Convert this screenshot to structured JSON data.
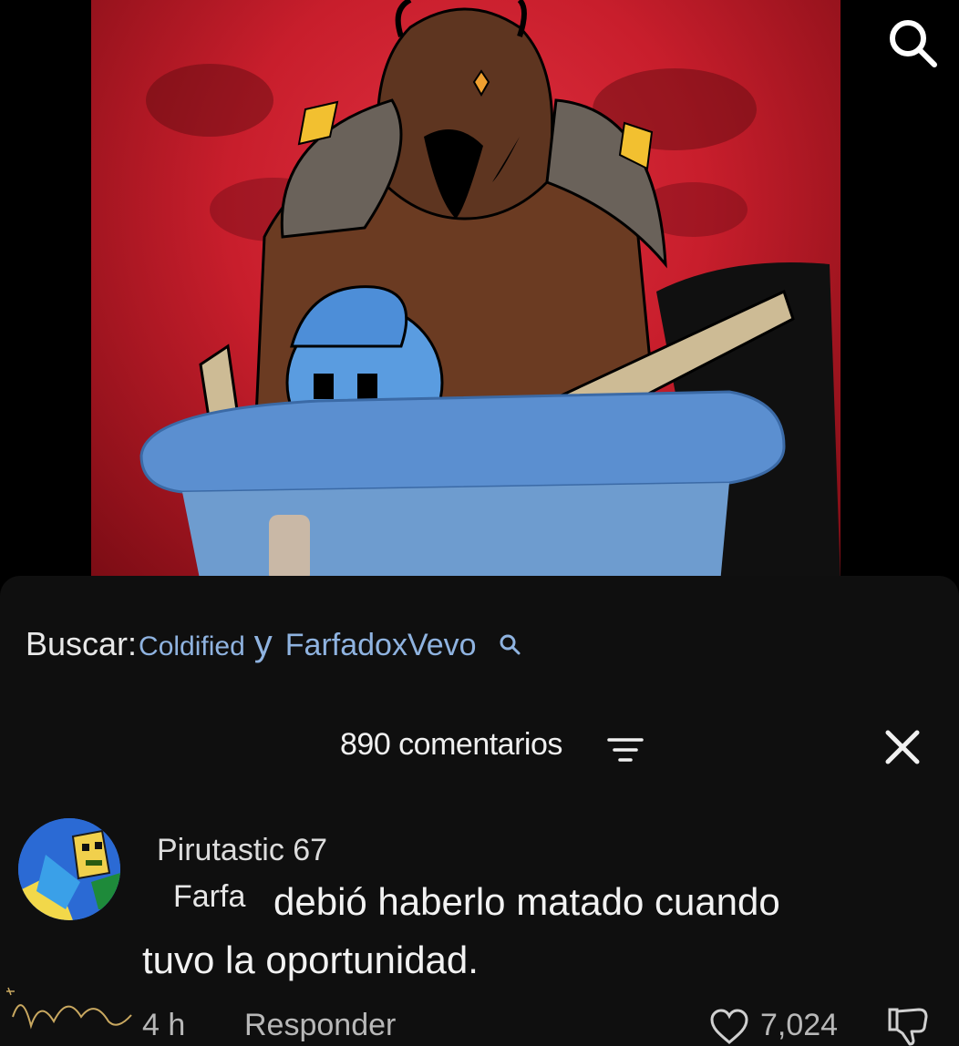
{
  "search": {
    "label": "Buscar:",
    "query_1": "Coldified",
    "joiner": "y",
    "query_2": "FarfadoxVevo"
  },
  "comments": {
    "count_label": "890 comentarios"
  },
  "comment": {
    "author": "Pirutastic 67",
    "text_prefix": "Farfa",
    "text_line1": "debió haberlo matado cuando",
    "text_line2": "tuvo la oportunidad.",
    "time": "4 h",
    "reply_label": "Responder",
    "likes": "7,024"
  },
  "icons": {
    "top_search": "search-icon",
    "inline_search": "search-icon",
    "sort": "sort-icon",
    "close": "close-icon",
    "like": "heart-icon",
    "dislike": "thumbs-down-icon"
  },
  "colors": {
    "background": "#0f0f0f",
    "link": "#8fb3e0",
    "video_bg": "#c81e2c"
  }
}
